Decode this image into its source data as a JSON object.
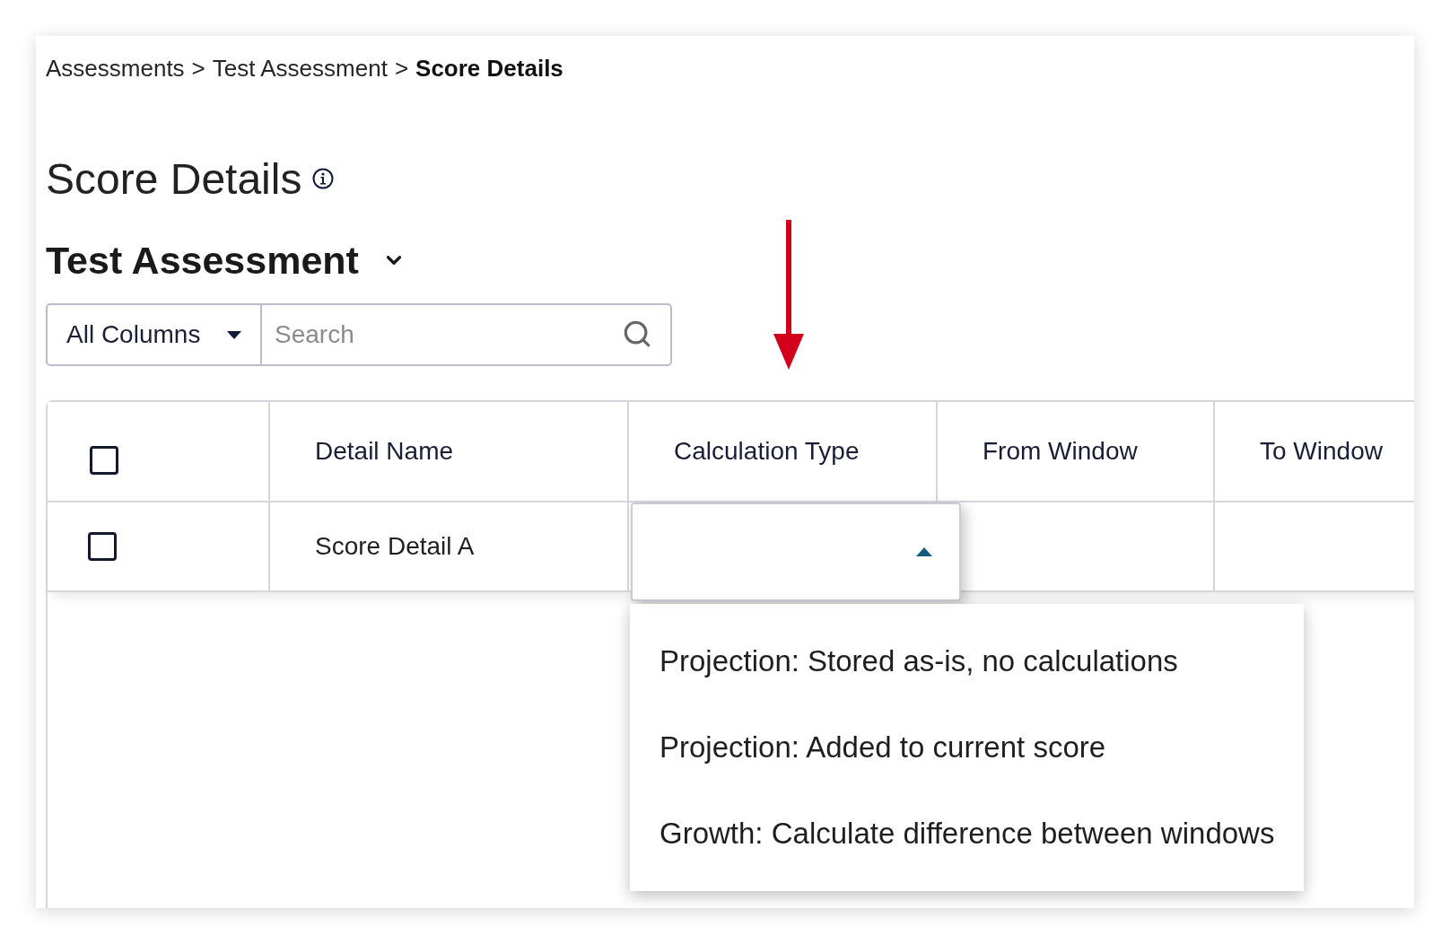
{
  "breadcrumb": [
    {
      "label": "Assessments",
      "current": false,
      "separator": ">"
    },
    {
      "label": "Test Assessment",
      "current": false,
      "separator": ">"
    },
    {
      "label": "Score Details",
      "current": true
    }
  ],
  "page_title": {
    "text": "Score Details",
    "info_icon": true
  },
  "assessment_selector": {
    "label": "Test Assessment",
    "expanded": false
  },
  "filter": {
    "column_select": {
      "value": "All Columns"
    },
    "search": {
      "placeholder": "Search"
    }
  },
  "table": {
    "select_all": {
      "checked": false
    },
    "columns": [
      {
        "label": "Detail Name"
      },
      {
        "label": "Calculation Type"
      },
      {
        "label": "From Window"
      },
      {
        "label": "To Window"
      }
    ],
    "rows": [
      {
        "checked": false,
        "detail_name": "Score Detail A",
        "calculation_type": {
          "open": true,
          "options": [
            {
              "label": "Projection: Stored as-is, no calculations",
              "selected": false
            },
            {
              "label": "Projection: Added to current score",
              "selected": false
            },
            {
              "label": "Growth: Calculate difference between windows",
              "selected": false
            }
          ]
        }
      }
    ]
  }
}
